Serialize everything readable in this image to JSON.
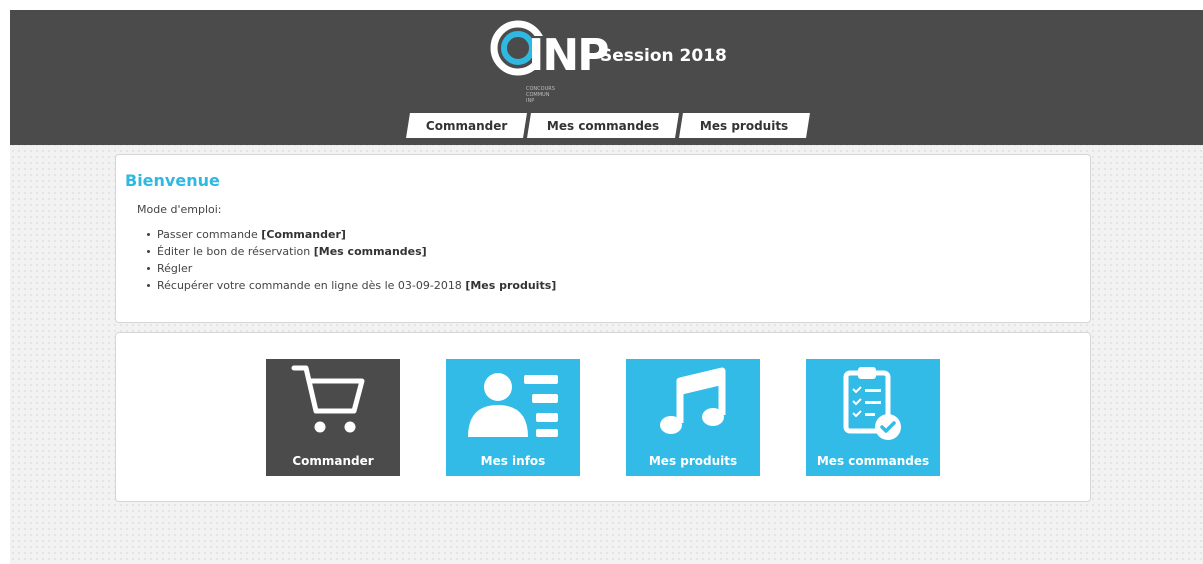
{
  "header": {
    "logo_text": "INP",
    "logo_subtext": [
      "CONCOURS",
      "COMMUN",
      "INP"
    ],
    "session_label": "Session 2018"
  },
  "nav": {
    "tabs": [
      {
        "label": "Commander"
      },
      {
        "label": "Mes commandes"
      },
      {
        "label": "Mes produits"
      }
    ]
  },
  "welcome": {
    "title": "Bienvenue",
    "mode_label": "Mode d'emploi:",
    "items": [
      {
        "text": "Passer commande ",
        "link": "[Commander]"
      },
      {
        "text": "Éditer le bon de réservation ",
        "link": "[Mes commandes]"
      },
      {
        "text": "Régler",
        "link": ""
      },
      {
        "text": "Récupérer votre commande en ligne dès le 03-09-2018 ",
        "link": "[Mes produits]"
      }
    ]
  },
  "tiles": [
    {
      "label": "Commander",
      "icon": "cart-icon",
      "color": "#4b4b4b"
    },
    {
      "label": "Mes infos",
      "icon": "user-list-icon",
      "color": "#32bbe7"
    },
    {
      "label": "Mes produits",
      "icon": "music-note-icon",
      "color": "#32bbe7"
    },
    {
      "label": "Mes commandes",
      "icon": "clipboard-check-icon",
      "color": "#32bbe7"
    }
  ],
  "colors": {
    "header_bg": "#4b4b4b",
    "accent": "#2eb8e2",
    "tile_blue": "#32bbe7",
    "tile_dark": "#4b4b4b"
  }
}
